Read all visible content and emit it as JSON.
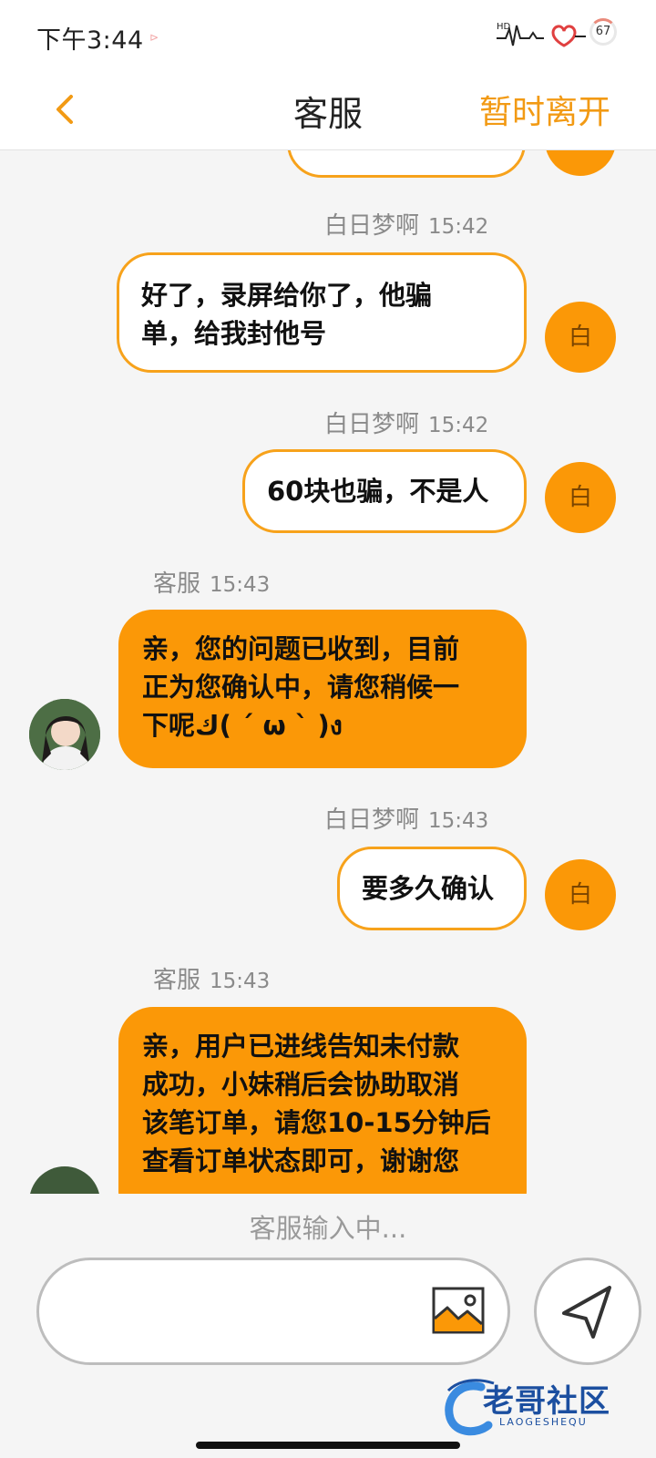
{
  "status_bar": {
    "time": "下午3:44",
    "indicator": "HD",
    "battery": "67"
  },
  "header": {
    "back_icon": "chevron-left-icon",
    "title": "客服",
    "leave_label": "暂时离开"
  },
  "colors": {
    "accent": "#f29a14",
    "bubble_in": "#fb9807",
    "bubble_out_border": "#f7a21b"
  },
  "messages": [
    {
      "from": "me",
      "sender": "白日梦啊",
      "time": "15:42",
      "text": "好了，录屏给你了，他骗\n单，给我封他号",
      "avatar": "白"
    },
    {
      "from": "me",
      "sender": "白日梦啊",
      "time": "15:42",
      "text": "60块也骗，不是人",
      "avatar": "白"
    },
    {
      "from": "cs",
      "sender": "客服",
      "time": "15:43",
      "text": "亲，您的问题已收到，目前\n正为您确认中，请您稍候一\n下呢ك(  ´ ω ` )ง"
    },
    {
      "from": "me",
      "sender": "白日梦啊",
      "time": "15:43",
      "text": "要多久确认",
      "avatar": "白"
    },
    {
      "from": "cs",
      "sender": "客服",
      "time": "15:43",
      "text": "亲，用户已进线告知未付款\n成功，小妹稍后会协助取消\n该笔订单，请您10-15分钟后\n查看订单状态即可，谢谢您"
    }
  ],
  "partial_top_avatar": "白",
  "typing_text": "客服输入中...",
  "input": {
    "value": "",
    "placeholder": ""
  },
  "icons": {
    "image": "image-icon",
    "send": "send-icon"
  },
  "watermark": {
    "text": "老哥社区",
    "sub": "LAOGESHEQU"
  }
}
